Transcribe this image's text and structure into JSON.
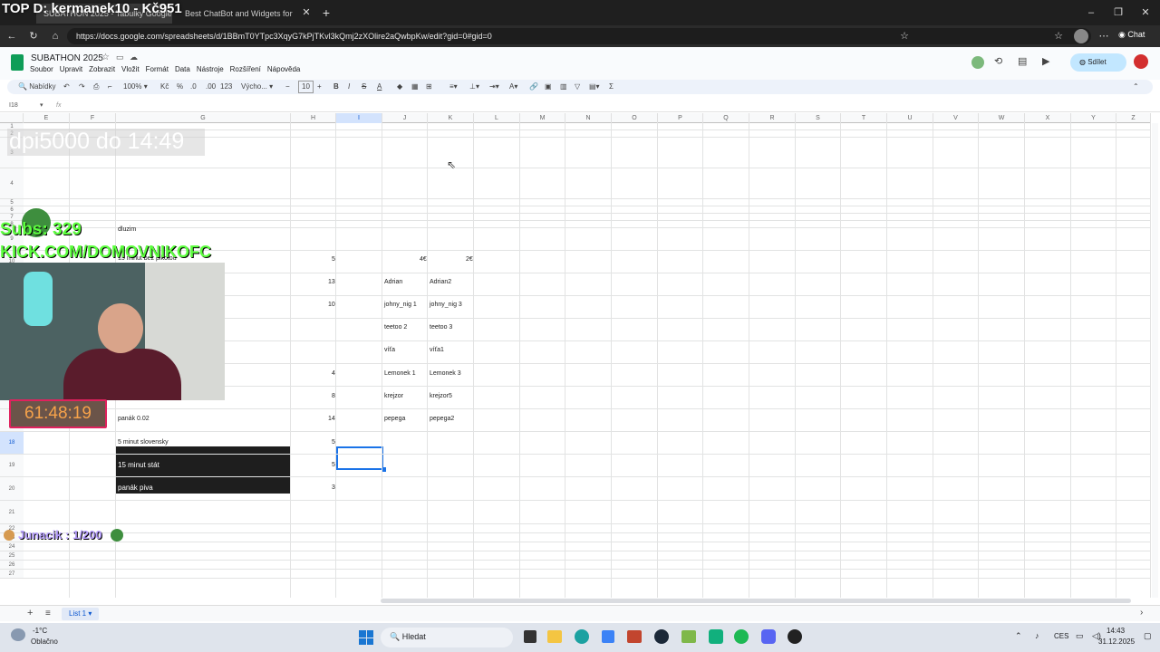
{
  "overlay": {
    "top_title": "TOP D: kermanek10 - Kč951",
    "dpi": "dpi5000 do 14:49",
    "subs": "Subs: 329",
    "kick": "KICK.COM/DOMOVNIKOFC",
    "timer": "61:48:19",
    "junacik": "Junacik : 1/200"
  },
  "browser": {
    "tab1": "SUBATHON 2025 - Tabulky Google",
    "tab2": "Best ChatBot and Widgets for",
    "url": "https://docs.google.com/spreadsheets/d/1BBmT0YTpc3XqyG7kPjTKvl3kQmj2zXOlire2aQwbpKw/edit?gid=0#gid=0",
    "chat": "Chat"
  },
  "sheets": {
    "title": "SUBATHON 2025",
    "menu": [
      "Soubor",
      "Upravit",
      "Zobrazit",
      "Vložit",
      "Formát",
      "Data",
      "Nástroje",
      "Rozšíření",
      "Nápověda"
    ],
    "share": "Sdílet",
    "toolbar": {
      "search": "Nabídky",
      "zoom": "100%",
      "currency": "Kč",
      "percent": "%",
      "dec1": ".0",
      "dec2": ".00",
      "num": "123",
      "font": "Výcho...",
      "size": "10"
    },
    "cellref": "I18",
    "fx": "fx",
    "sheet_tab": "List 1"
  },
  "columns": [
    "E",
    "F",
    "G",
    "H",
    "I",
    "J",
    "K",
    "L",
    "M",
    "N",
    "O",
    "P",
    "Q",
    "R",
    "S",
    "T",
    "U",
    "V",
    "W",
    "X",
    "Y",
    "Z"
  ],
  "rows": [
    "1",
    "2",
    "3",
    "4",
    "5",
    "6",
    "7",
    "8",
    "9",
    "10",
    "11",
    "12",
    "13",
    "14",
    "15",
    "16",
    "17",
    "18",
    "19",
    "20",
    "21",
    "22",
    "23",
    "24",
    "25",
    "26",
    "27"
  ],
  "cells": {
    "dluzim": "dluzim",
    "minut_bez": "15 minut bez pikotou",
    "h9": "5",
    "j9": "4€",
    "k9": "2€",
    "h10": "13",
    "j10": "Adrian",
    "k10": "Adrian2",
    "h11": "10",
    "j11": "johny_nig 1",
    "k11": "johny_nig 3",
    "j12": "teetoo 2",
    "k12": "teetoo 3",
    "j13": "víťa",
    "k13": "víťa1",
    "h14": "4",
    "j14": "Lemonek 1",
    "k14": "Lemonek 3",
    "h15": "8",
    "j15": "krejzor",
    "k15": "krejzor5",
    "g16": "panák 0.02",
    "h16": "14",
    "j16": "pepega",
    "k16": "pepega2",
    "g17": "5 minut slovensky",
    "h17": "5",
    "g18": "15 minut stát",
    "h18": "5",
    "g19": "panák piva",
    "h19": "3"
  },
  "taskbar": {
    "temp": "-1°C",
    "weather": "Oblačno",
    "search": "Hledat",
    "lang": "CES",
    "time": "14:43",
    "date": "31.12.2025"
  }
}
